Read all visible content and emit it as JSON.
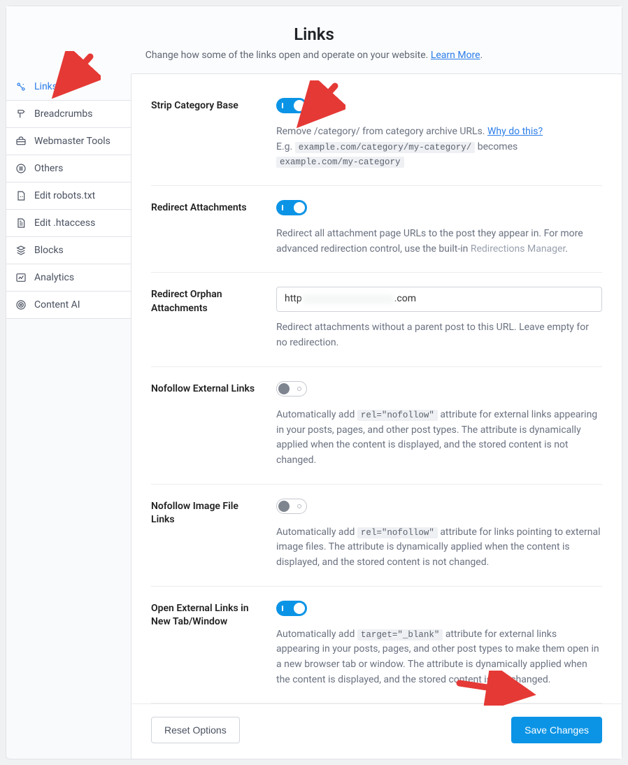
{
  "header": {
    "title": "Links",
    "subtitle_prefix": "Change how some of the links open and operate on your website. ",
    "learn_more": "Learn More"
  },
  "sidebar": {
    "items": [
      {
        "label": "Links",
        "icon": "links-icon",
        "active": true
      },
      {
        "label": "Breadcrumbs",
        "icon": "signpost-icon",
        "active": false
      },
      {
        "label": "Webmaster Tools",
        "icon": "toolbox-icon",
        "active": false
      },
      {
        "label": "Others",
        "icon": "circle-list-icon",
        "active": false
      },
      {
        "label": "Edit robots.txt",
        "icon": "robot-file-icon",
        "active": false
      },
      {
        "label": "Edit .htaccess",
        "icon": "document-icon",
        "active": false
      },
      {
        "label": "Blocks",
        "icon": "blocks-icon",
        "active": false
      },
      {
        "label": "Analytics",
        "icon": "chart-icon",
        "active": false
      },
      {
        "label": "Content AI",
        "icon": "target-icon",
        "active": false
      }
    ]
  },
  "settings": {
    "strip_category_base": {
      "label": "Strip Category Base",
      "desc_a": "Remove /category/ from category archive URLs. ",
      "why_link": "Why do this?",
      "desc_b_prefix": "E.g. ",
      "code1": "example.com/category/my-category/",
      "mid": " becomes ",
      "code2": "example.com/my-category"
    },
    "redirect_attachments": {
      "label": "Redirect Attachments",
      "desc_a": "Redirect all attachment page URLs to the post they appear in. For more advanced redirection control, use the built-in  ",
      "link": "Redirections Manager",
      "desc_b": "."
    },
    "redirect_orphan": {
      "label": "Redirect Orphan Attachments",
      "value_prefix": "http",
      "value_suffix": ".com",
      "desc": "Redirect attachments without a parent post to this URL. Leave empty for no redirection."
    },
    "nofollow_external": {
      "label": "Nofollow External Links",
      "desc_a": "Automatically add ",
      "code": "rel=\"nofollow\"",
      "desc_b": " attribute for external links appearing in your posts, pages, and other post types. The attribute is dynamically applied when the content is displayed, and the stored content is not changed."
    },
    "nofollow_image": {
      "label": "Nofollow Image File Links",
      "desc_a": "Automatically add ",
      "code": "rel=\"nofollow\"",
      "desc_b": " attribute for links pointing to external image files. The attribute is dynamically applied when the content is displayed, and the stored content is not changed."
    },
    "open_external": {
      "label": "Open External Links in New Tab/Window",
      "desc_a": "Automatically add ",
      "code": "target=\"_blank\"",
      "desc_b": " attribute for external links appearing in your posts, pages, and other post types to make them open in a new browser tab or window. The attribute is dynamically applied when the content is displayed, and the stored content is not changed."
    }
  },
  "footer": {
    "reset": "Reset Options",
    "save": "Save Changes"
  }
}
